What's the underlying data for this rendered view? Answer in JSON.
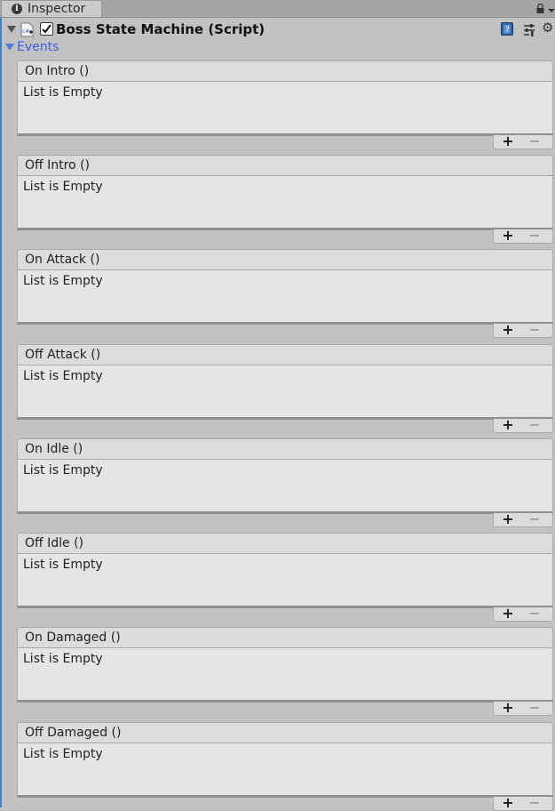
{
  "tab": {
    "label": "Inspector",
    "info_icon": "info-icon"
  },
  "component": {
    "title": "Boss State Machine (Script)",
    "enabled": true
  },
  "events_label": "Events",
  "events": [
    {
      "title": "On Intro ()",
      "empty_text": "List is Empty"
    },
    {
      "title": "Off Intro ()",
      "empty_text": "List is Empty"
    },
    {
      "title": "On Attack ()",
      "empty_text": "List is Empty"
    },
    {
      "title": "Off Attack ()",
      "empty_text": "List is Empty"
    },
    {
      "title": "On Idle ()",
      "empty_text": "List is Empty"
    },
    {
      "title": "Off Idle ()",
      "empty_text": "List is Empty"
    },
    {
      "title": "On Damaged ()",
      "empty_text": "List is Empty"
    },
    {
      "title": "Off Damaged ()",
      "empty_text": "List is Empty"
    }
  ],
  "buttons": {
    "add": "+",
    "remove": "−"
  },
  "colors": {
    "accent": "#3b83c9",
    "events_label": "#3a5fe0",
    "panel_bg": "#c2c2c2"
  }
}
